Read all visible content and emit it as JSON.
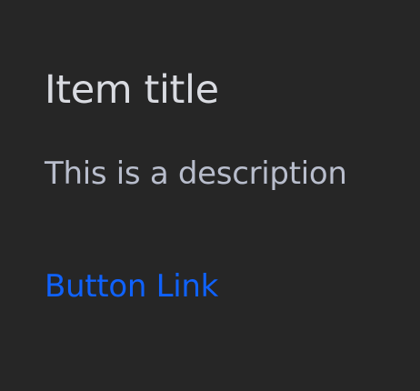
{
  "card": {
    "title": "Item title",
    "description": "This is a description",
    "link_label": "Button Link"
  },
  "colors": {
    "background": "#262626",
    "title": "#d9dbe1",
    "description": "#b8bdcc",
    "link": "#0f62fe"
  }
}
